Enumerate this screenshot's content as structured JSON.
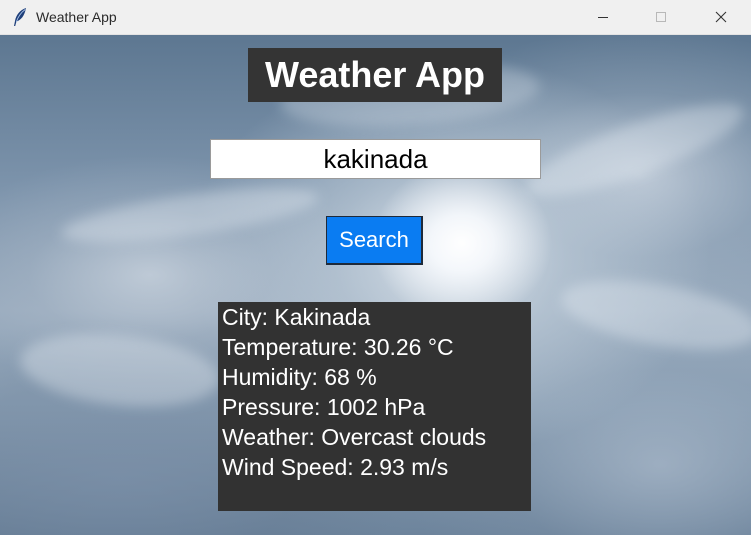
{
  "window": {
    "title": "Weather App",
    "icon": "feather-icon",
    "controls": [
      "minimize-icon",
      "maximize-icon",
      "close-icon"
    ]
  },
  "app": {
    "heading": "Weather App",
    "search": {
      "value": "kakinada",
      "button_label": "Search"
    },
    "results": [
      "City: Kakinada",
      "Temperature: 30.26 °C",
      "Humidity: 68 %",
      "Pressure: 1002 hPa",
      "Weather: Overcast clouds",
      "Wind Speed: 2.93 m/s"
    ]
  },
  "colors": {
    "title_bar": "#f0f0f0",
    "heading_bg": "#343434",
    "results_bg": "#323232",
    "button_bg": "#0a7cf2",
    "text_light": "#ffffff"
  }
}
